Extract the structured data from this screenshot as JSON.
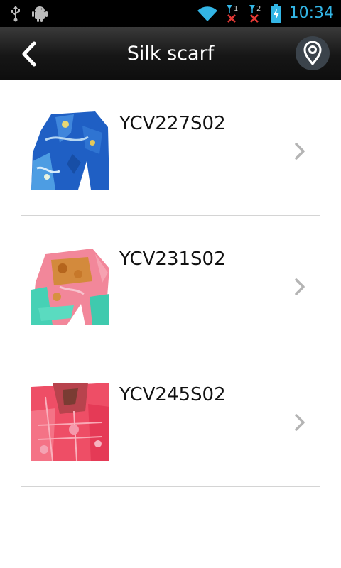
{
  "status_bar": {
    "time": "10:34",
    "sim1_label": "1",
    "sim2_label": "2",
    "icons": [
      "usb-icon",
      "android-icon",
      "wifi-icon",
      "sim1-no-signal-icon",
      "sim2-no-signal-icon",
      "battery-charging-icon"
    ],
    "clock_color": "#33b5e5"
  },
  "header": {
    "title": "Silk scarf",
    "back_icon": "chevron-left-icon",
    "location_icon": "location-pin-icon"
  },
  "products": [
    {
      "code": "YCV227S02",
      "image": "blue-silk-scarf"
    },
    {
      "code": "YCV231S02",
      "image": "pink-turquoise-silk-scarf"
    },
    {
      "code": "YCV245S02",
      "image": "red-pink-silk-scarf"
    }
  ]
}
